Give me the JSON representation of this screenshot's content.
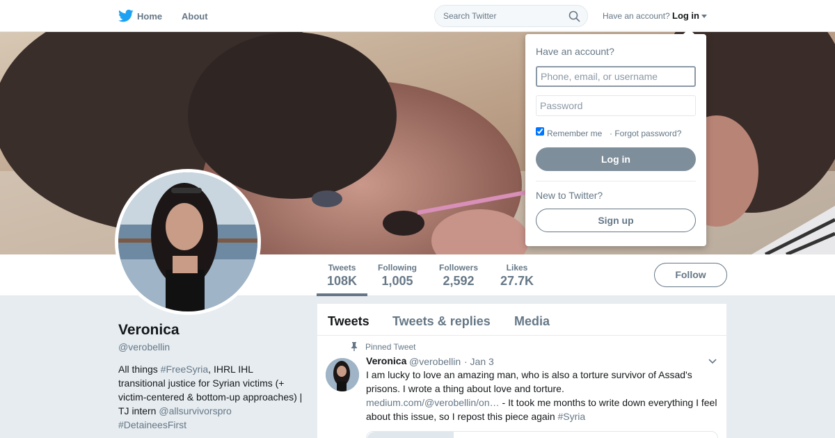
{
  "nav": {
    "home_label": "Home",
    "about_label": "About",
    "search_placeholder": "Search Twitter",
    "have_account": "Have an account?",
    "login_label": "Log in"
  },
  "stats": [
    {
      "label": "Tweets",
      "value": "108K"
    },
    {
      "label": "Following",
      "value": "1,005"
    },
    {
      "label": "Followers",
      "value": "2,592"
    },
    {
      "label": "Likes",
      "value": "27.7K"
    }
  ],
  "follow_label": "Follow",
  "profile": {
    "name": "Veronica",
    "handle": "@verobellin",
    "bio_parts": {
      "p1": "All things ",
      "tag1": "#FreeSyria",
      "p2": ", IHRL IHL transitional justice for Syrian victims (+ victim-centered & bottom-up approaches) | TJ intern ",
      "mention": "@allsurvivorspro",
      "tag2": "#DetaineesFirst"
    }
  },
  "timeline": {
    "tabs": [
      "Tweets",
      "Tweets & replies",
      "Media"
    ],
    "pinned_label": "Pinned Tweet",
    "tweet": {
      "name": "Veronica",
      "handle": "@verobellin",
      "date": "· Jan 3",
      "text_p1": "I am lucky to love an amazing man, who is also a torture survivor of Assad's prisons. I wrote a thing about love and torture.",
      "link": "medium.com/@verobellin/on…",
      "text_p2": " - It took me months to write down everything I feel about this issue, so I repost this piece again ",
      "hashtag": "#Syria"
    }
  },
  "login_dropdown": {
    "title": "Have an account?",
    "username_placeholder": "Phone, email, or username",
    "password_placeholder": "Password",
    "remember_label": "Remember me",
    "forgot_label": "· Forgot password?",
    "login_button": "Log in",
    "new_label": "New to Twitter?",
    "signup_button": "Sign up"
  },
  "colors": {
    "brand": "#1da1f2",
    "muted": "#657786",
    "text": "#14171a"
  }
}
